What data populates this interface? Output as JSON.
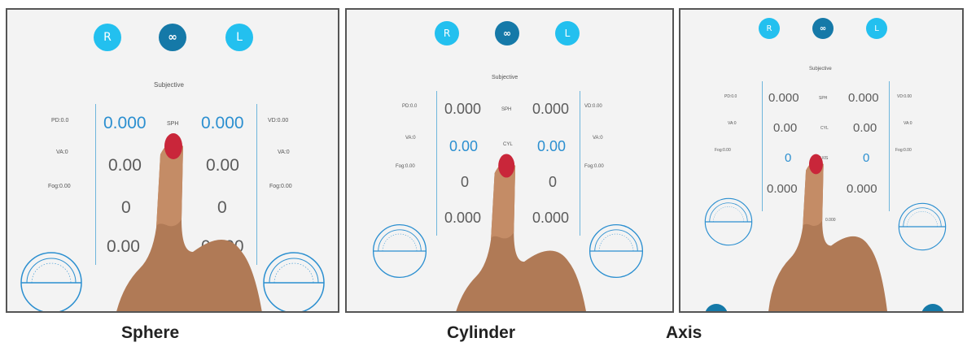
{
  "captions": [
    "Sphere",
    "Cylinder",
    "Axis"
  ],
  "colors": {
    "accent_light": "#23c0ef",
    "accent_dark": "#1579a8",
    "highlight_value": "#2b8fd0",
    "divider": "#6fb6dc",
    "panel_bg": "#f3f3f3",
    "panel_border": "#555555"
  },
  "panels": [
    {
      "buttons": {
        "right": "R",
        "both": "∞",
        "left": "L"
      },
      "header": "Subjective",
      "labels": {
        "pd": "PD:0.0",
        "va_left": "VA:0",
        "fog_left": "Fog:0.00",
        "vd": "VD:0.00",
        "va_right": "VA:0",
        "fog_right": "Fog:0.00",
        "sph": "SPH",
        "cyl": "",
        "axis": "",
        "add": ""
      },
      "values": {
        "sph_r": "0.000",
        "sph_l": "0.000",
        "cyl_r": "0.00",
        "cyl_l": "0.00",
        "axis_r": "0",
        "axis_l": "0",
        "add_r": "0.00",
        "add_l": "0.000"
      },
      "highlighted_row": "sph"
    },
    {
      "buttons": {
        "right": "R",
        "both": "∞",
        "left": "L"
      },
      "header": "Subjective",
      "labels": {
        "pd": "PD:0.0",
        "va_left": "VA:0",
        "fog_left": "Fog:0.00",
        "vd": "VD:0.00",
        "va_right": "VA:0",
        "fog_right": "Fog:0.00",
        "sph": "SPH",
        "cyl": "CYL",
        "axis": "",
        "add": ""
      },
      "values": {
        "sph_r": "0.000",
        "sph_l": "0.000",
        "cyl_r": "0.00",
        "cyl_l": "0.00",
        "axis_r": "0",
        "axis_l": "0",
        "add_r": "0.000",
        "add_l": "0.000"
      },
      "highlighted_row": "cyl"
    },
    {
      "buttons": {
        "right": "R",
        "both": "∞",
        "left": "L"
      },
      "header": "Subjective",
      "labels": {
        "pd": "PD:0.0",
        "va_left": "VA:0",
        "fog_left": "Fog:0.00",
        "vd": "VD:0.00",
        "va_right": "VA:0",
        "fog_right": "Fog:0.00",
        "sph": "SPH",
        "cyl": "CYL",
        "axis": "AXIS",
        "add": "",
        "extra": "0.000"
      },
      "values": {
        "sph_r": "0.000",
        "sph_l": "0.000",
        "cyl_r": "0.00",
        "cyl_l": "0.00",
        "axis_r": "0",
        "axis_l": "0",
        "add_r": "0.000",
        "add_l": "0.000"
      },
      "highlighted_row": "axis"
    }
  ]
}
